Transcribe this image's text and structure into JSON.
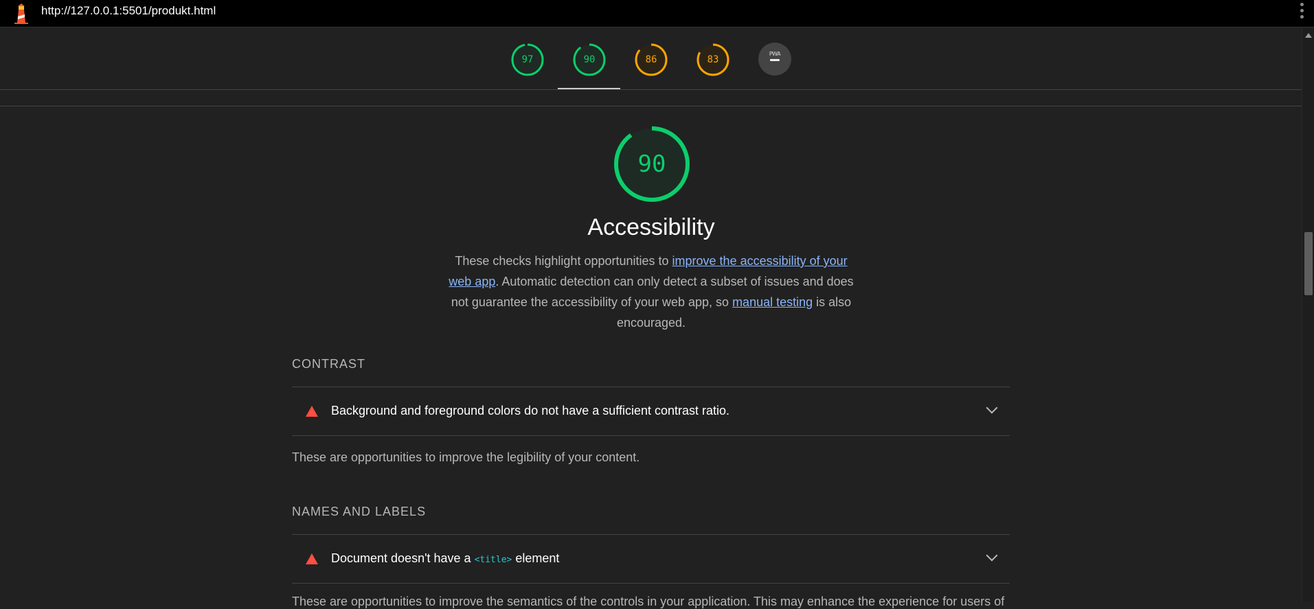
{
  "browser": {
    "url": "http://127.0.0.1:5501/produkt.html"
  },
  "scores": [
    {
      "value": "97",
      "color": "#0cce6b",
      "fraction": 0.97
    },
    {
      "value": "90",
      "color": "#0cce6b",
      "fraction": 0.9
    },
    {
      "value": "86",
      "color": "#ffa400",
      "fraction": 0.86
    },
    {
      "value": "83",
      "color": "#ffa400",
      "fraction": 0.83
    }
  ],
  "pwa": {
    "label": "PWA"
  },
  "category": {
    "score": "90",
    "score_fraction": 0.9,
    "title": "Accessibility",
    "desc_before": "These checks highlight opportunities to ",
    "link1": "improve the accessibility of your web app",
    "desc_middle": ". Automatic detection can only detect a subset of issues and does not guarantee the accessibility of your web app, so ",
    "link2": "manual testing",
    "desc_after": " is also encouraged."
  },
  "groups": [
    {
      "title": "CONTRAST",
      "audit": "Background and foreground colors do not have a sufficient contrast ratio.",
      "description": "These are opportunities to improve the legibility of your content."
    },
    {
      "title": "NAMES AND LABELS",
      "audit_before": "Document doesn't have a ",
      "audit_code": "<title>",
      "audit_after": " element",
      "description": "These are opportunities to improve the semantics of the controls in your application. This may enhance the experience for users of"
    }
  ],
  "colors": {
    "pass": "#0cce6b",
    "average": "#ffa400",
    "fail": "#ff4e42",
    "link": "#8ab4f8",
    "background": "#212121"
  }
}
